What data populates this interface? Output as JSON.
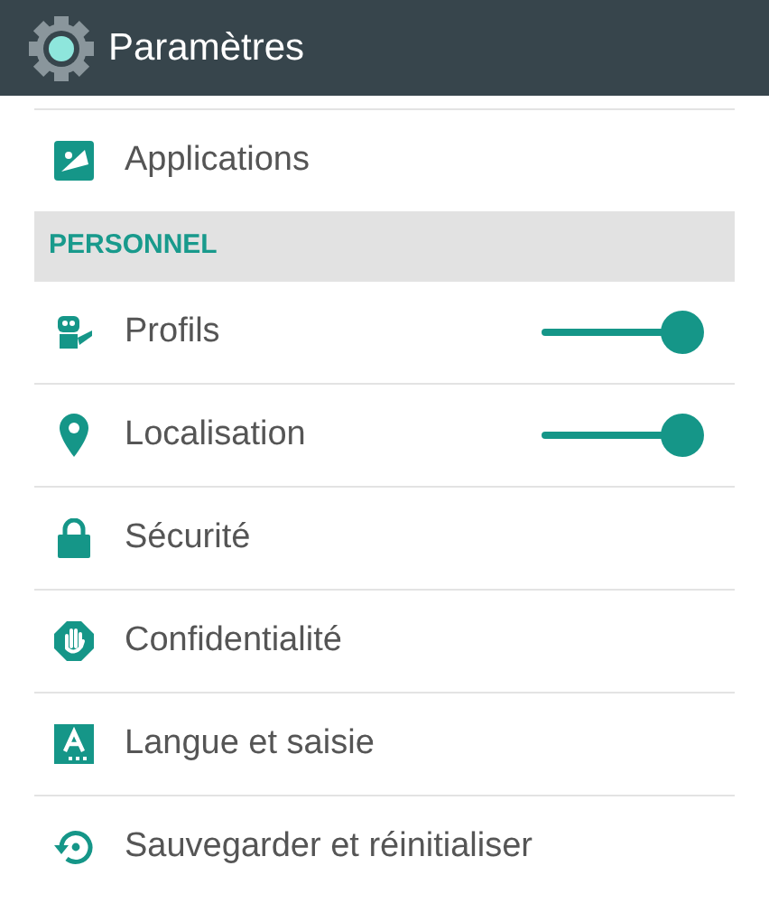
{
  "toolbar": {
    "title": "Paramètres"
  },
  "list": [
    {
      "kind": "item",
      "label": "Applications"
    },
    {
      "kind": "header",
      "label": "PERSONNEL"
    },
    {
      "kind": "switch",
      "label": "Profils",
      "on": true
    },
    {
      "kind": "switch",
      "label": "Localisation",
      "on": true
    },
    {
      "kind": "item",
      "label": "Sécurité"
    },
    {
      "kind": "item",
      "label": "Confidentialité"
    },
    {
      "kind": "item",
      "label": "Langue et saisie"
    },
    {
      "kind": "item",
      "label": "Sauvegarder et réinitialiser"
    }
  ]
}
